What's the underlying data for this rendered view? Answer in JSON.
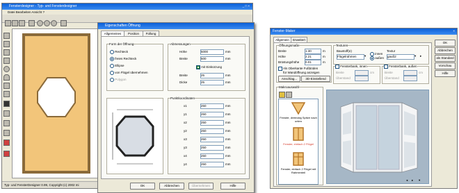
{
  "left_app": {
    "title": "Fensterdesigner - Typ- und Fensterdesigner",
    "menu": "Datei  Bearbeiten  Ansicht  ?",
    "status": "Typ- und FensterDesigner 0.99, Copyright (c) 2002 mi",
    "window_controls": "_ □ ×"
  },
  "dialog_left": {
    "title": "Eigenschaften Öffnung",
    "tabs": [
      "Allgemeines",
      "Position",
      "Füllung"
    ],
    "form_group": "Form der Öffnung",
    "form_options": [
      "Rechteck",
      "freies Rechteck",
      "Ellipse",
      "von Flügel übernehmen",
      "Polygon"
    ],
    "dims_group": "Abmessungen",
    "dims": [
      {
        "label": "Höhe",
        "value": "5000",
        "unit": "mm"
      },
      {
        "label": "Breite",
        "value": "500",
        "unit": "mm"
      }
    ],
    "chamfer_label": "mit Einkürzung",
    "chamfer": [
      {
        "label": "Breite",
        "value": "25",
        "unit": "mm"
      },
      {
        "label": "Dicke",
        "value": "25",
        "unit": "mm"
      }
    ],
    "coords_group": "Punktkoordinaten",
    "coords": [
      "x1",
      "y1",
      "x2",
      "y2",
      "x3",
      "y3",
      "x4",
      "y4"
    ],
    "coord_value": "250",
    "coord_unit": "mm",
    "buttons": [
      "OK",
      "Abbrechen",
      "Übernehmen",
      "Hilfe"
    ]
  },
  "dialog_right": {
    "title": "Fenster-Maker",
    "tabs": [
      "Allgemein",
      "Erweitert"
    ],
    "group_opening": "Öffnungsmaße",
    "fields": [
      {
        "label": "Breite",
        "value": "1.30",
        "unit": "m"
      },
      {
        "label": "Höhe",
        "value": "2.21",
        "unit": "m"
      },
      {
        "label": "Brüstungshöhe",
        "value": "0.01",
        "unit": "m"
      }
    ],
    "check1": "Als Oberkante Fußböden",
    "check1b": "für Wandöffnung anzeigen",
    "btn_anschlag": "Anschlag...",
    "btn_3d": "3D-Einstellend",
    "group_textures": "Texturen",
    "baustoff_label": "Baustoff(e)",
    "baustoff_value": "Flügelrahmen",
    "radio_innen": "innen",
    "radio_aussen": "außen",
    "textur_label": "Textur",
    "textur_value": "gauß2",
    "sill_inner": "Fensterbank, innen",
    "sill_outer": "Fensterbank, außen",
    "sill_fields": [
      "Breite",
      "Überstand"
    ],
    "sill_units": "cm",
    "gallery_label": "Makroauswahl",
    "gallery_items": [
      "Fenster, dreieckig Spitze nach unten",
      "Fenster, einfach 2 Flügel",
      "Fenster, einfach 2 Flügel mit Rahmenteil"
    ],
    "buttons": [
      "OK",
      "Abbrechen",
      "als Standard",
      "Vorschau",
      "Hilfe"
    ]
  },
  "colors": {
    "titlebar": "#0a5fd8",
    "frame_wood": "#f2c57a",
    "selected_text": "#d63a2a",
    "preview_bg": "#a6b7c6"
  }
}
